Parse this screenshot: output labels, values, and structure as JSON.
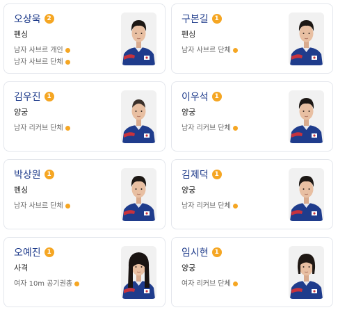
{
  "medalists": [
    {
      "name": "오상욱",
      "medal_count": "2",
      "sport": "펜싱",
      "events": [
        "남자 사브르 개인",
        "남자 사브르 단체"
      ],
      "hair": "short",
      "medal_color": "#f5a623"
    },
    {
      "name": "구본길",
      "medal_count": "1",
      "sport": "펜싱",
      "events": [
        "남자 사브르 단체"
      ],
      "hair": "short",
      "medal_color": "#f5a623"
    },
    {
      "name": "김우진",
      "medal_count": "1",
      "sport": "양궁",
      "events": [
        "남자 리커브 단체"
      ],
      "hair": "buzz",
      "medal_color": "#f5a623"
    },
    {
      "name": "이우석",
      "medal_count": "1",
      "sport": "양궁",
      "events": [
        "남자 리커브 단체"
      ],
      "hair": "short",
      "medal_color": "#f5a623"
    },
    {
      "name": "박상원",
      "medal_count": "1",
      "sport": "펜싱",
      "events": [
        "남자 사브르 단체"
      ],
      "hair": "short",
      "medal_color": "#f5a623"
    },
    {
      "name": "김제덕",
      "medal_count": "1",
      "sport": "양궁",
      "events": [
        "남자 리커브 단체"
      ],
      "hair": "short",
      "medal_color": "#f5a623"
    },
    {
      "name": "오예진",
      "medal_count": "1",
      "sport": "사격",
      "events": [
        "여자 10m 공기권총"
      ],
      "hair": "long",
      "medal_color": "#f5a623"
    },
    {
      "name": "임시현",
      "medal_count": "1",
      "sport": "양궁",
      "events": [
        "여자 리커브 단체"
      ],
      "hair": "bob",
      "medal_color": "#f5a623"
    }
  ]
}
